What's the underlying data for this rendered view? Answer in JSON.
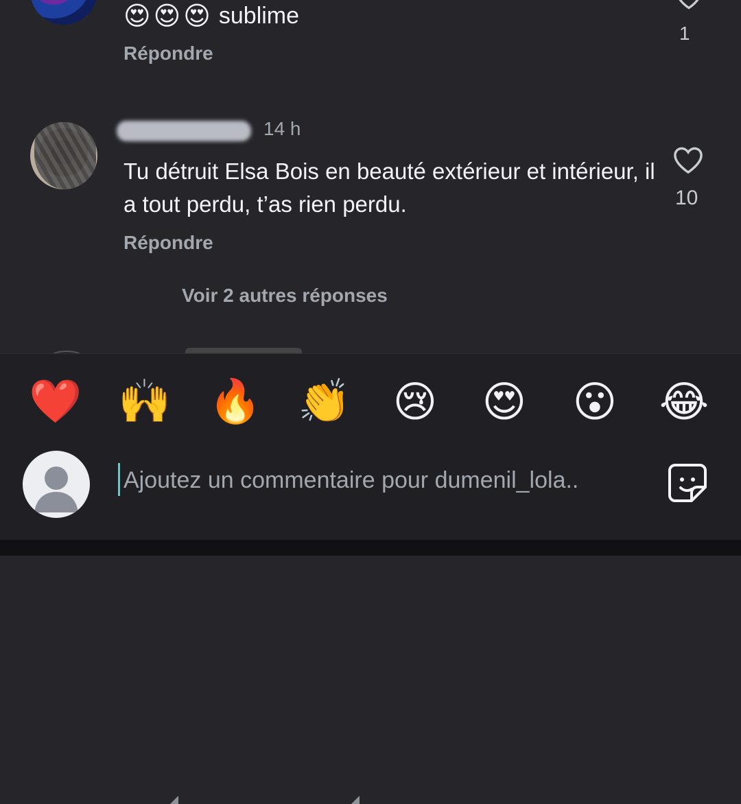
{
  "comments": [
    {
      "emojis": [
        "😍",
        "😍",
        "😍"
      ],
      "text": "sublime",
      "reply_label": "Répondre",
      "like_count": "1"
    },
    {
      "timestamp": "14 h",
      "text": "Tu détruit Elsa Bois en beauté extérieur et intérieur, il a tout perdu, t’as rien perdu.",
      "reply_label": "Répondre",
      "like_count": "10",
      "view_replies": "Voir 2 autres réponses"
    }
  ],
  "reactions": [
    "❤️",
    "🙌",
    "🔥",
    "👏",
    "😢",
    "😍",
    "😮",
    "😂"
  ],
  "composer": {
    "placeholder": "Ajoutez un commentaire pour dumenil_lola.."
  },
  "icons": {
    "like": "heart-outline-icon",
    "sticker": "sticker-icon",
    "avatar": "user-avatar-icon"
  },
  "colors": {
    "background": "#25252a",
    "muted_text": "#a3a8b0",
    "caret": "#6ec6c6"
  }
}
